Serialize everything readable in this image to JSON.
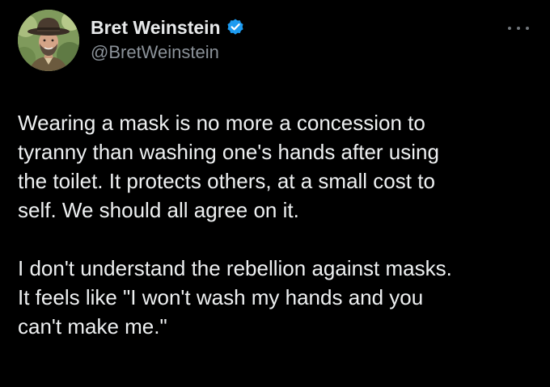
{
  "author": {
    "display_name": "Bret Weinstein",
    "handle": "@BretWeinstein",
    "verified": true,
    "verified_icon": "verified-badge-icon",
    "avatar_icon": "profile-photo-avatar"
  },
  "tweet": {
    "paragraphs": [
      "Wearing a mask is no more a concession to\ntyranny than washing one's hands after using\nthe toilet. It protects others, at a small cost to\nself. We should all agree on it.",
      "I don't understand the rebellion against masks.\nIt feels like \"I won't wash my hands and you\ncan't make me.\""
    ]
  },
  "menu": {
    "icon": "more-options-icon"
  },
  "colors": {
    "background": "#000000",
    "text": "#e7e9ea",
    "secondary_text": "#8b9299",
    "verified_blue": "#1d9bf0"
  }
}
